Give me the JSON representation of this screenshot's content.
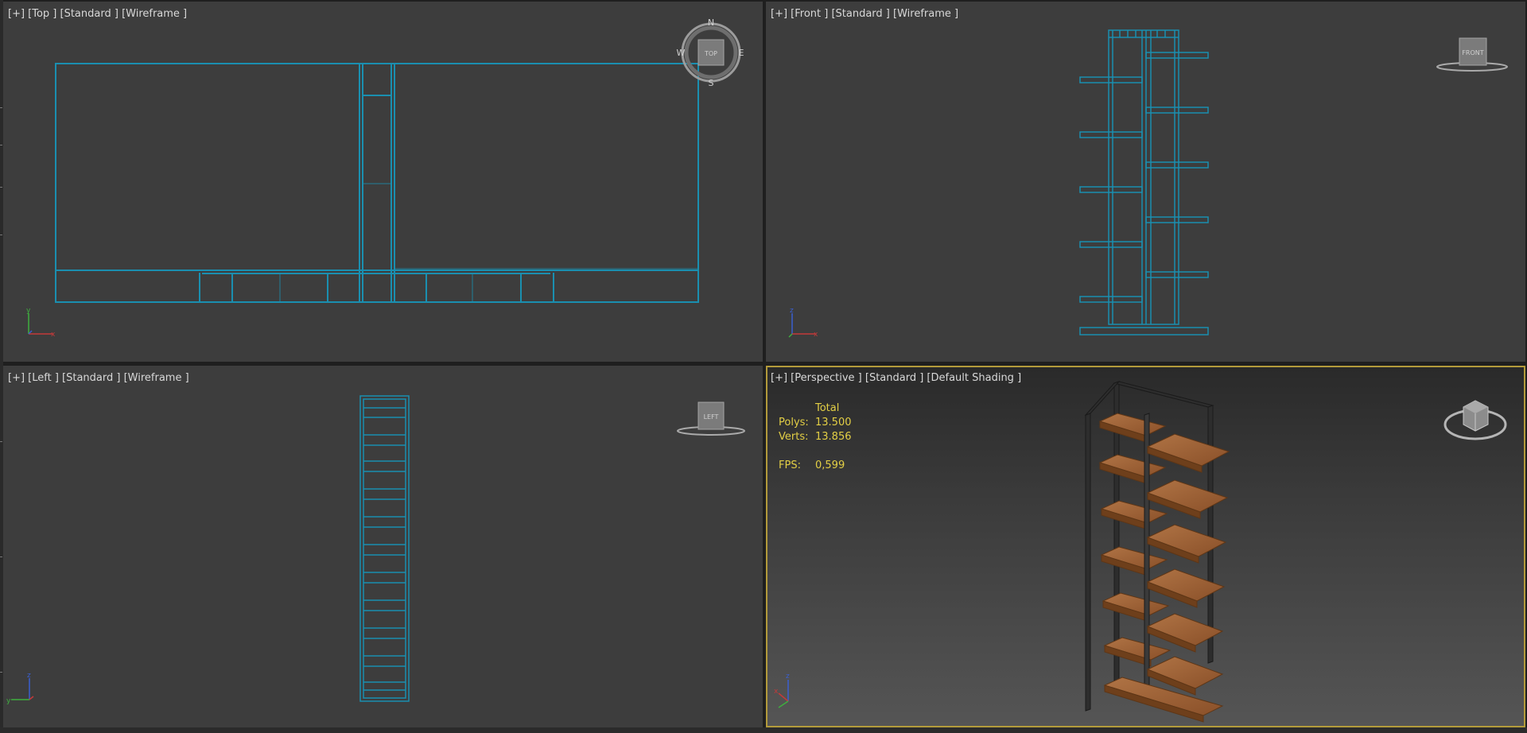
{
  "viewports": {
    "top": {
      "label": "[+] [Top ] [Standard ] [Wireframe ]",
      "gizmo": "TOP",
      "compass": {
        "n": "N",
        "s": "S",
        "e": "E",
        "w": "W"
      },
      "axes": {
        "v": "y",
        "h": "x"
      }
    },
    "front": {
      "label": "[+] [Front ] [Standard ] [Wireframe ]",
      "gizmo": "FRONT",
      "axes": {
        "v": "z",
        "h": "x"
      }
    },
    "left": {
      "label": "[+] [Left ] [Standard ] [Wireframe ]",
      "gizmo": "LEFT",
      "axes": {
        "v": "z",
        "h": "y"
      }
    },
    "perspective": {
      "label": "[+] [Perspective ] [Standard ] [Default Shading ]",
      "stats": {
        "header": "Total",
        "polys_label": "Polys:",
        "polys": "13.500",
        "verts_label": "Verts:",
        "verts": "13.856",
        "fps_label": "FPS:",
        "fps": "0,599"
      },
      "axes": {
        "v": "z",
        "h": "x"
      }
    }
  },
  "colors": {
    "wire": "#1a8fb0",
    "active_border": "#b39b3b",
    "stats_text": "#e3cf45",
    "wood": "#9a5f33",
    "metal": "#2d2d2d"
  }
}
